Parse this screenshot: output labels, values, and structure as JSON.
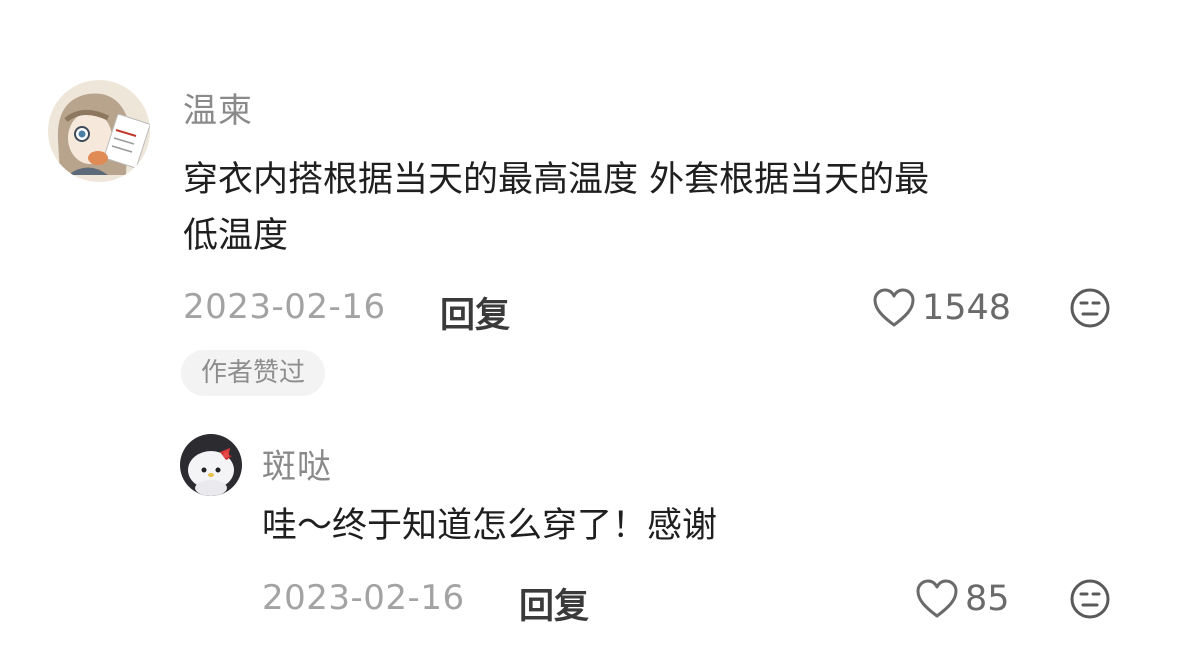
{
  "comment": {
    "username": "温柬",
    "text_line1": "穿衣内搭根据当天的最高温度 外套根据当天的最",
    "text_line2": "低温度",
    "date": "2023-02-16",
    "reply_label": "回复",
    "like_count": "1548",
    "author_badge": "作者赞过",
    "icons": {
      "like": "heart-outline-icon",
      "emoji": "neutral-face-icon"
    }
  },
  "reply": {
    "username": "斑哒",
    "text": "哇～终于知道怎么穿了！感谢",
    "date": "2023-02-16",
    "reply_label": "回复",
    "like_count": "85",
    "icons": {
      "like": "heart-outline-icon",
      "emoji": "neutral-face-icon"
    }
  },
  "colors": {
    "username": "#8a8a8a",
    "text": "#1f1f1f",
    "meta": "#a3a3a3",
    "badge_bg": "#f3f3f3"
  }
}
